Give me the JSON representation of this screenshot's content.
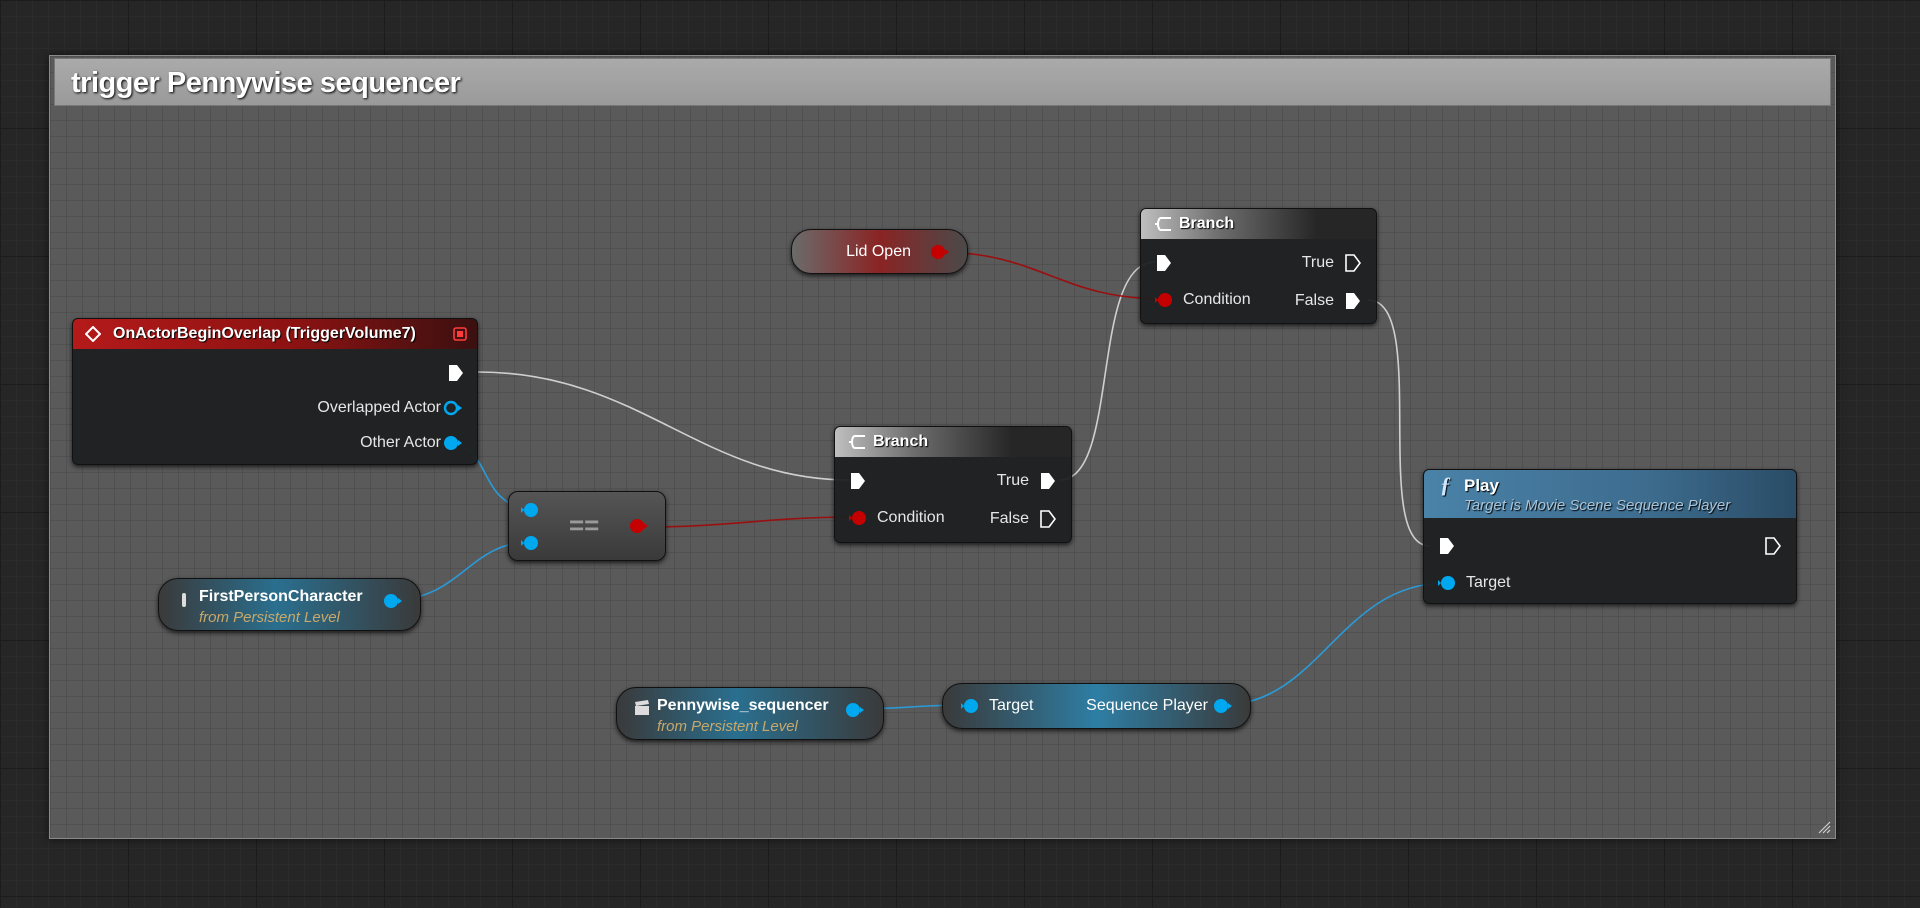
{
  "comment": {
    "title": "trigger Pennywise sequencer"
  },
  "nodes": {
    "event": {
      "title": "OnActorBeginOverlap (TriggerVolume7)",
      "pins": {
        "overlapped_actor": "Overlapped Actor",
        "other_actor": "Other Actor"
      }
    },
    "lid_open": {
      "label": "Lid Open"
    },
    "branch_top": {
      "title": "Branch",
      "pins": {
        "condition": "Condition",
        "true": "True",
        "false": "False"
      }
    },
    "branch_mid": {
      "title": "Branch",
      "pins": {
        "condition": "Condition",
        "true": "True",
        "false": "False"
      }
    },
    "equals": {
      "label": "=="
    },
    "first_person": {
      "label": "FirstPersonCharacter",
      "sub": "from Persistent Level"
    },
    "pennywise": {
      "label": "Pennywise_sequencer",
      "sub": "from Persistent Level"
    },
    "sequence_player": {
      "in_label": "Target",
      "out_label": "Sequence Player"
    },
    "play": {
      "title": "Play",
      "subtitle": "Target is Movie Scene Sequence Player",
      "pins": {
        "target": "Target"
      }
    }
  },
  "colors": {
    "exec": "#ffffff",
    "bool": "#950000",
    "object": "#00a8f0",
    "exec_wire": "#d0d0d0",
    "bool_wire": "#a01010",
    "object_wire": "#2a9ad8"
  }
}
